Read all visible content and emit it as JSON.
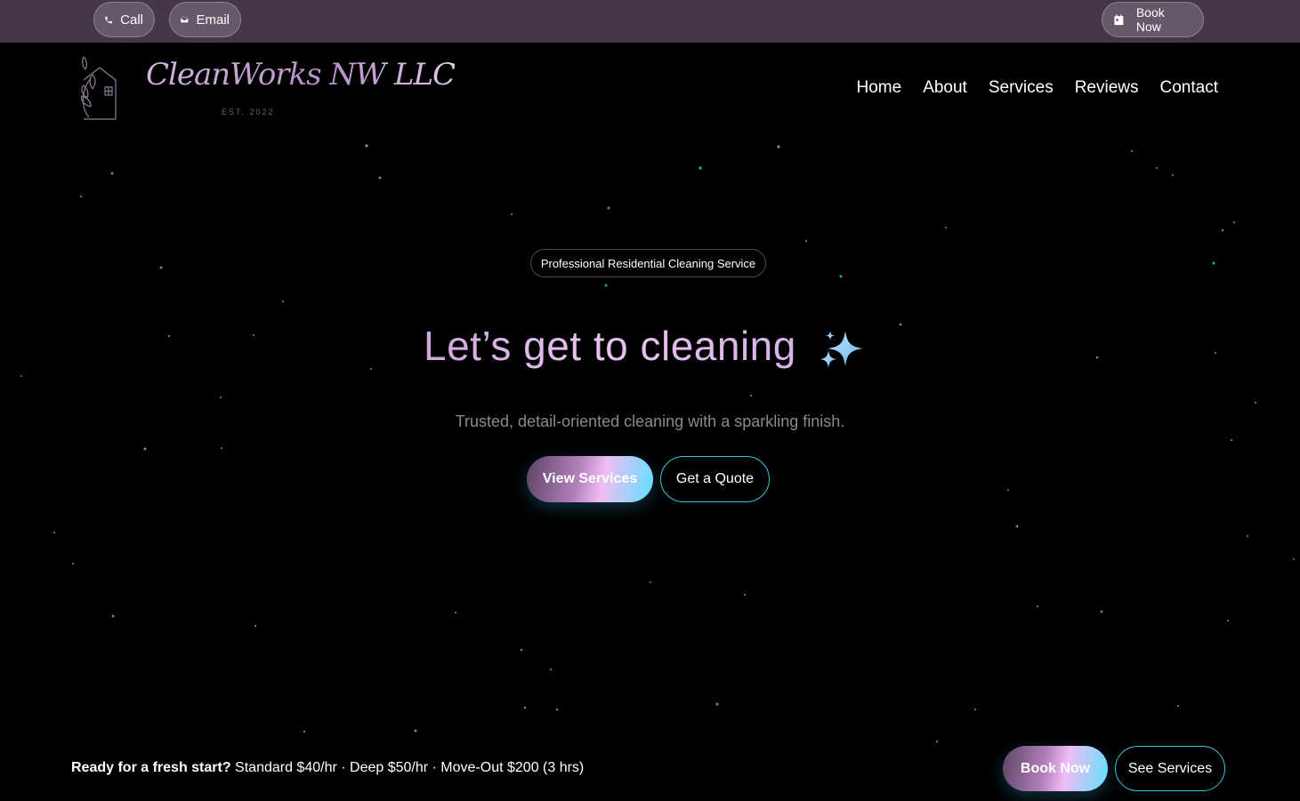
{
  "topbar": {
    "call_label": "Call",
    "email_label": "Email",
    "book_label": "Book Now",
    "background": "#453648"
  },
  "logo": {
    "name": "CleanWorks NW LLC",
    "est": "EST. 2022"
  },
  "nav": {
    "items": [
      {
        "label": "Home"
      },
      {
        "label": "About"
      },
      {
        "label": "Services"
      },
      {
        "label": "Reviews"
      },
      {
        "label": "Contact"
      }
    ]
  },
  "hero": {
    "badge": "Professional Residential Cleaning Service",
    "title": "Let’s get to cleaning",
    "sparkle_icon": "sparkles-icon",
    "subtitle": "Trusted, detail-oriented cleaning with a sparkling finish.",
    "primary_cta": "View Services",
    "secondary_cta": "Get a Quote"
  },
  "bottom_bar": {
    "lead": "Ready for a fresh start?",
    "pricing": " Standard $40/hr · Deep $50/hr · Move-Out $200 (3 hrs)",
    "book_label": "Book Now",
    "services_label": "See Services"
  },
  "colors": {
    "accent_cyan": "#39c5de",
    "accent_lilac": "#d2b6dc",
    "background": "#000000"
  }
}
